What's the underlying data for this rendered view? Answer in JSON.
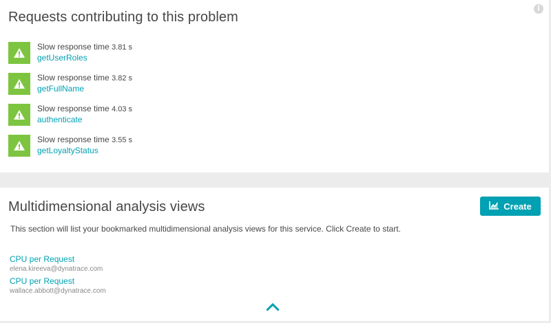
{
  "requests_panel": {
    "title": "Requests contributing to this problem",
    "info_icon": "info-icon",
    "items": [
      {
        "label": "Slow response time",
        "value": "3.81 s",
        "link": "getUserRoles",
        "icon": "warning-icon"
      },
      {
        "label": "Slow response time",
        "value": "3.82 s",
        "link": "getFullName",
        "icon": "warning-icon"
      },
      {
        "label": "Slow response time",
        "value": "4.03 s",
        "link": "authenticate",
        "icon": "warning-icon"
      },
      {
        "label": "Slow response time",
        "value": "3.55 s",
        "link": "getLoyaltyStatus",
        "icon": "warning-icon"
      }
    ]
  },
  "mda_panel": {
    "title": "Multidimensional analysis views",
    "create_label": "Create",
    "create_icon": "chart-icon",
    "description": "This section will list your bookmarked multidimensional analysis views for this service. Click Create to start.",
    "views": [
      {
        "name": "CPU per Request",
        "owner": "elena.kireeva@dynatrace.com"
      },
      {
        "name": "CPU per Request",
        "owner": "wallace.abbott@dynatrace.com"
      }
    ],
    "collapse_icon": "chevron-up-icon"
  },
  "colors": {
    "accent": "#00a1b2",
    "warning_green": "#7dc540",
    "text": "#454646",
    "muted": "#898989",
    "background": "#ececec"
  }
}
